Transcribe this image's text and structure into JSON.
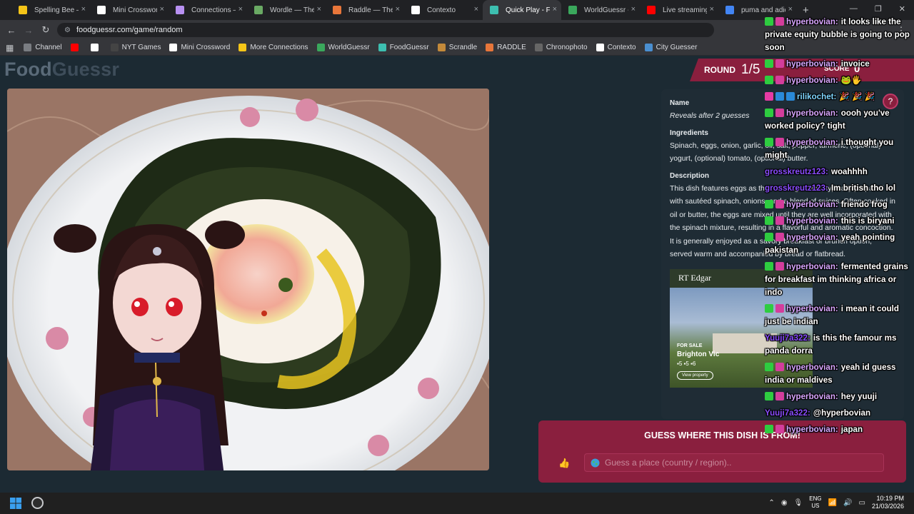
{
  "browser": {
    "tabs": [
      {
        "label": "Spelling Bee — Th",
        "color": "#f5c518",
        "active": false
      },
      {
        "label": "Mini Crossword -",
        "color": "#ffffff",
        "active": false
      },
      {
        "label": "Connections — Th",
        "color": "#b891f2",
        "active": false
      },
      {
        "label": "Wordle — The Ne",
        "color": "#6aaa64",
        "active": false
      },
      {
        "label": "Raddle — The W",
        "color": "#e8763a",
        "active": false
      },
      {
        "label": "Contexto",
        "color": "#ffffff",
        "active": false
      },
      {
        "label": "Quick Play - Food",
        "color": "#3dbfb0",
        "active": true
      },
      {
        "label": "WorldGuessr - Pla",
        "color": "#3aa85c",
        "active": false
      },
      {
        "label": "Live streaming - Y",
        "color": "#ff0000",
        "active": false
      },
      {
        "label": "puma and adidas",
        "color": "#4285f4",
        "active": false
      }
    ],
    "url": "foodguessr.com/game/random",
    "bookmarks": [
      {
        "label": "Channel",
        "color": "#7a7d82"
      },
      {
        "label": "",
        "color": "#ff0000"
      },
      {
        "label": "",
        "color": "#ffffff"
      },
      {
        "label": "NYT Games",
        "color": "#444"
      },
      {
        "label": "Mini Crossword",
        "color": "#ffffff"
      },
      {
        "label": "More Connections",
        "color": "#f5c518"
      },
      {
        "label": "WorldGuessr",
        "color": "#3aa85c"
      },
      {
        "label": "FoodGuessr",
        "color": "#3dbfb0"
      },
      {
        "label": "Scrandle",
        "color": "#c48a3a"
      },
      {
        "label": "RADDLE",
        "color": "#e8763a"
      },
      {
        "label": "Chronophoto",
        "color": "#666"
      },
      {
        "label": "Contexto",
        "color": "#ffffff"
      },
      {
        "label": "City Guesser",
        "color": "#4a8fd0"
      }
    ]
  },
  "app": {
    "logo_part1": "Food",
    "logo_part2": "Guessr",
    "round_label": "ROUND",
    "round_value": "1/5",
    "score_label": "SCORE",
    "score_value": "0",
    "help_icon": "?"
  },
  "info": {
    "name_head": "Name",
    "name_body": "Reveals after 2 guesses",
    "ingredients_head": "Ingredients",
    "ingredients_body": "Spinach, eggs, onion, garlic, oil, salt, pepper, turmeric, (optional) yogurt, (optional) tomato, (optional) butter.",
    "description_head": "Description",
    "description_body": "This dish features eggs as the main ingredient, typically prepared with sautéed spinach, onions, and a blend of spices. Often cooked in oil or butter, the eggs are mixed until they are well incorporated with the spinach mixture, resulting in a flavorful and aromatic concoction. It is generally enjoyed as a savory breakfast or brunch option, served warm and accompanied by bread or flatbread.",
    "ad_brand": "RT Edgar",
    "ad_location": "Brighton Vic",
    "ad_meta": "▪5 ▪5 ▪6",
    "ad_button": "View property",
    "ad_sale": "FOR SALE"
  },
  "guess": {
    "title": "GUESS WHERE THIS DISH IS FROM!",
    "placeholder": "Guess a place (country / region).."
  },
  "chat": [
    {
      "user": "hyperbovian:",
      "text": "it looks like the private equity bubble is going to pop soon",
      "badges": [
        "green",
        "mod"
      ],
      "color": "#d8a6ff"
    },
    {
      "user": "hyperbovian:",
      "text": "invoice",
      "badges": [
        "green",
        "mod"
      ],
      "color": "#d8a6ff"
    },
    {
      "user": "hyperbovian:",
      "text": "🐸🖐",
      "badges": [
        "green",
        "mod"
      ],
      "color": "#d8a6ff"
    },
    {
      "user": "rilikochet:",
      "text": "🎉 🎉 🎉",
      "badges": [
        "pink",
        "blue",
        "blue"
      ],
      "color": "#7fd6ff"
    },
    {
      "user": "hyperbovian:",
      "text": "oooh you've worked policy? tight",
      "badges": [
        "green",
        "mod"
      ],
      "color": "#d8a6ff"
    },
    {
      "user": "hyperbovian:",
      "text": "i thought you might",
      "badges": [
        "green",
        "mod"
      ],
      "color": "#d8a6ff"
    },
    {
      "user": "grosskreutz123:",
      "text": "woahhhh",
      "badges": [],
      "color": "#8a4dff"
    },
    {
      "user": "grosskreutz123:",
      "text": "Im british tho lol",
      "badges": [],
      "color": "#8a4dff"
    },
    {
      "user": "hyperbovian:",
      "text": "friendo frog",
      "badges": [
        "green",
        "mod"
      ],
      "color": "#d8a6ff"
    },
    {
      "user": "hyperbovian:",
      "text": "this is biryani",
      "badges": [
        "green",
        "mod"
      ],
      "color": "#d8a6ff"
    },
    {
      "user": "hyperbovian:",
      "text": "yeah pointing pakistan",
      "badges": [
        "green",
        "mod"
      ],
      "color": "#d8a6ff"
    },
    {
      "user": "hyperbovian:",
      "text": "fermented grains for breakfast im thinking africa or indo",
      "badges": [
        "green",
        "mod"
      ],
      "color": "#d8a6ff"
    },
    {
      "user": "hyperbovian:",
      "text": "i mean it could just be indian",
      "badges": [
        "green",
        "mod"
      ],
      "color": "#d8a6ff"
    },
    {
      "user": "Yuuji7a322:",
      "text": "is this the famour ms panda dorra",
      "badges": [],
      "color": "#8a4dff"
    },
    {
      "user": "hyperbovian:",
      "text": "yeah id guess india or maldives",
      "badges": [
        "green",
        "mod"
      ],
      "color": "#d8a6ff"
    },
    {
      "user": "hyperbovian:",
      "text": "hey yuuji",
      "badges": [
        "green",
        "mod"
      ],
      "color": "#d8a6ff"
    },
    {
      "user": "Yuuji7a322:",
      "text": "@hyperbovian",
      "badges": [],
      "color": "#8a4dff"
    },
    {
      "user": "hyperbovian:",
      "text": "japan",
      "badges": [
        "green",
        "mod"
      ],
      "color": "#d8a6ff"
    }
  ],
  "taskbar": {
    "lang1": "ENG",
    "lang2": "US",
    "time": "10:19 PM",
    "date": "21/03/2026"
  }
}
